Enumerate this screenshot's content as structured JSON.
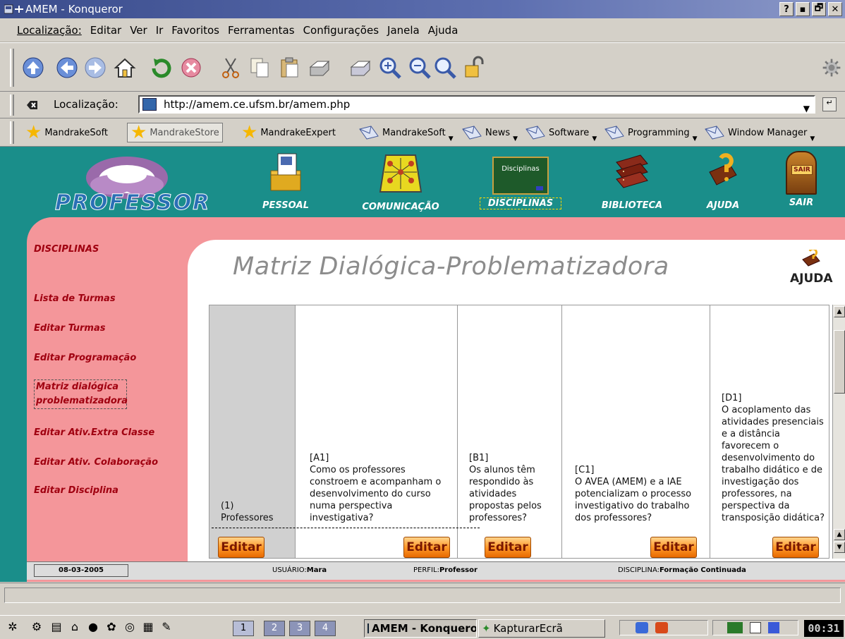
{
  "window": {
    "title": "AMEM - Konqueror",
    "buttons": [
      "?",
      "▪",
      "🗗",
      "✕"
    ]
  },
  "menu": [
    "Localização:",
    "Editar",
    "Ver",
    "Ir",
    "Favoritos",
    "Ferramentas",
    "Configurações",
    "Janela",
    "Ajuda"
  ],
  "toolbar": {
    "icons": [
      "up-icon",
      "back-icon",
      "forward-icon",
      "home-icon",
      "reload-icon",
      "stop-icon",
      "cut-icon",
      "copy-icon",
      "paste-icon",
      "print-icon",
      "print-frame-icon",
      "zoom-in-icon",
      "zoom-out-icon",
      "zoom-normal-icon",
      "security-icon"
    ]
  },
  "location": {
    "label": "Localização:",
    "url": "http://amem.ce.ufsm.br/amem.php"
  },
  "bookmarks": [
    {
      "label": "MandrakeSoft",
      "icon": "star-icon",
      "menu": false
    },
    {
      "label": "MandrakeStore",
      "icon": "star-icon",
      "menu": false
    },
    {
      "label": "MandrakeExpert",
      "icon": "star-icon",
      "menu": false
    },
    {
      "label": "MandrakeSoft",
      "icon": "envelope-icon",
      "menu": true
    },
    {
      "label": "News",
      "icon": "envelope-icon",
      "menu": true
    },
    {
      "label": "Software",
      "icon": "envelope-icon",
      "menu": true
    },
    {
      "label": "Programming",
      "icon": "envelope-icon",
      "menu": true
    },
    {
      "label": "Window Manager",
      "icon": "envelope-icon",
      "menu": true
    }
  ],
  "site": {
    "logo_text": "PROFESSOR",
    "nav": [
      {
        "label": "PESSOAL",
        "icon": "folder-icon"
      },
      {
        "label": "COMUNICAÇÃO",
        "icon": "network-icon"
      },
      {
        "label": "DISCIPLINAS",
        "icon": "chalkboard-icon",
        "board_text": "Disciplinas"
      },
      {
        "label": "BIBLIOTECA",
        "icon": "books-icon"
      },
      {
        "label": "AJUDA",
        "icon": "help-book-icon"
      },
      {
        "label": "SAIR",
        "icon": "exit-door-icon",
        "sign": "SAIR"
      }
    ],
    "sidebar": {
      "title": "DISCIPLINAS",
      "links": [
        "Lista de Turmas",
        "Editar Turmas",
        "Editar Programação",
        "Matriz dialógica problematizadora",
        "Editar Ativ.Extra Classe",
        "Editar Ativ. Colaboração",
        "Editar Disciplina"
      ]
    },
    "page_title": "Matriz Dialógica-Problematizadora",
    "help_label": "AJUDA",
    "matrix": {
      "columns": [
        {
          "code": "(1)",
          "text": "Professores"
        },
        {
          "code": "[A1]",
          "text": "Como os professores constroem e acompanham o desenvolvimento do curso numa perspectiva investigativa?"
        },
        {
          "code": "[B1]",
          "text": "Os alunos têm respondido às atividades propostas pelos professores?"
        },
        {
          "code": "[C1]",
          "text": "O AVEA (AMEM) e a IAE potencializam o processo investigativo do trabalho dos professores?"
        },
        {
          "code": "[D1]",
          "text": "O acoplamento das atividades presenciais e a distância favorecem o desenvolvimento do trabalho didático e de investigação dos professores, na perspectiva da transposição didática?"
        }
      ],
      "edit_label": "Editar"
    },
    "status": {
      "date": "08-03-2005",
      "user_label": "USUÁRIO:",
      "user": "Mara",
      "profile_label": "PERFIL:",
      "profile": "Professor",
      "discipline_label": "DISCIPLINA:",
      "discipline": "Formação Continuada"
    }
  },
  "taskbar": {
    "desktops": [
      "1",
      "2",
      "3",
      "4"
    ],
    "tasks": [
      "AMEM - Konqueror",
      "KapturarEcrã"
    ],
    "clock": "00:31"
  }
}
